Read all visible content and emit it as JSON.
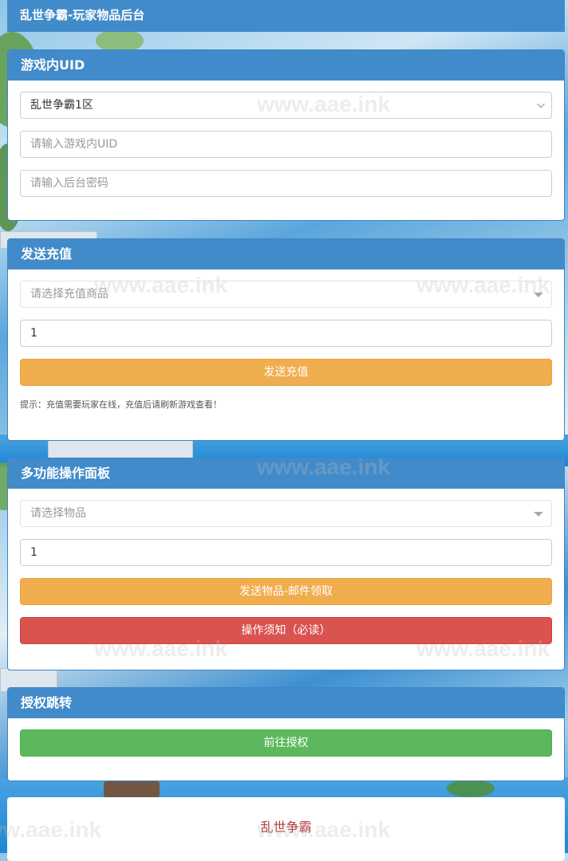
{
  "app_title": "乱世争霸-玩家物品后台",
  "uid_panel": {
    "title": "游戏内UID",
    "server_select_value": "乱世争霸1区",
    "uid_placeholder": "请输入游戏内UID",
    "password_placeholder": "请输入后台密码"
  },
  "recharge_panel": {
    "title": "发送充值",
    "product_placeholder": "请选择充值商品",
    "quantity_value": "1",
    "send_button": "发送充值",
    "hint": "提示：充值需要玩家在线，充值后请刷新游戏查看！"
  },
  "multi_panel": {
    "title": "多功能操作面板",
    "item_placeholder": "请选择物品",
    "quantity_value": "1",
    "send_mail_button": "发送物品-邮件领取",
    "notice_button": "操作须知（必读）"
  },
  "auth_panel": {
    "title": "授权跳转",
    "go_button": "前往授权"
  },
  "footer": {
    "brand": "乱世争霸"
  },
  "watermark": "www.aae.ink",
  "colors": {
    "primary": "#428bca",
    "warning": "#f0ad4e",
    "danger": "#d9534f",
    "success": "#5cb85c",
    "footer_text": "#b03a3a"
  }
}
